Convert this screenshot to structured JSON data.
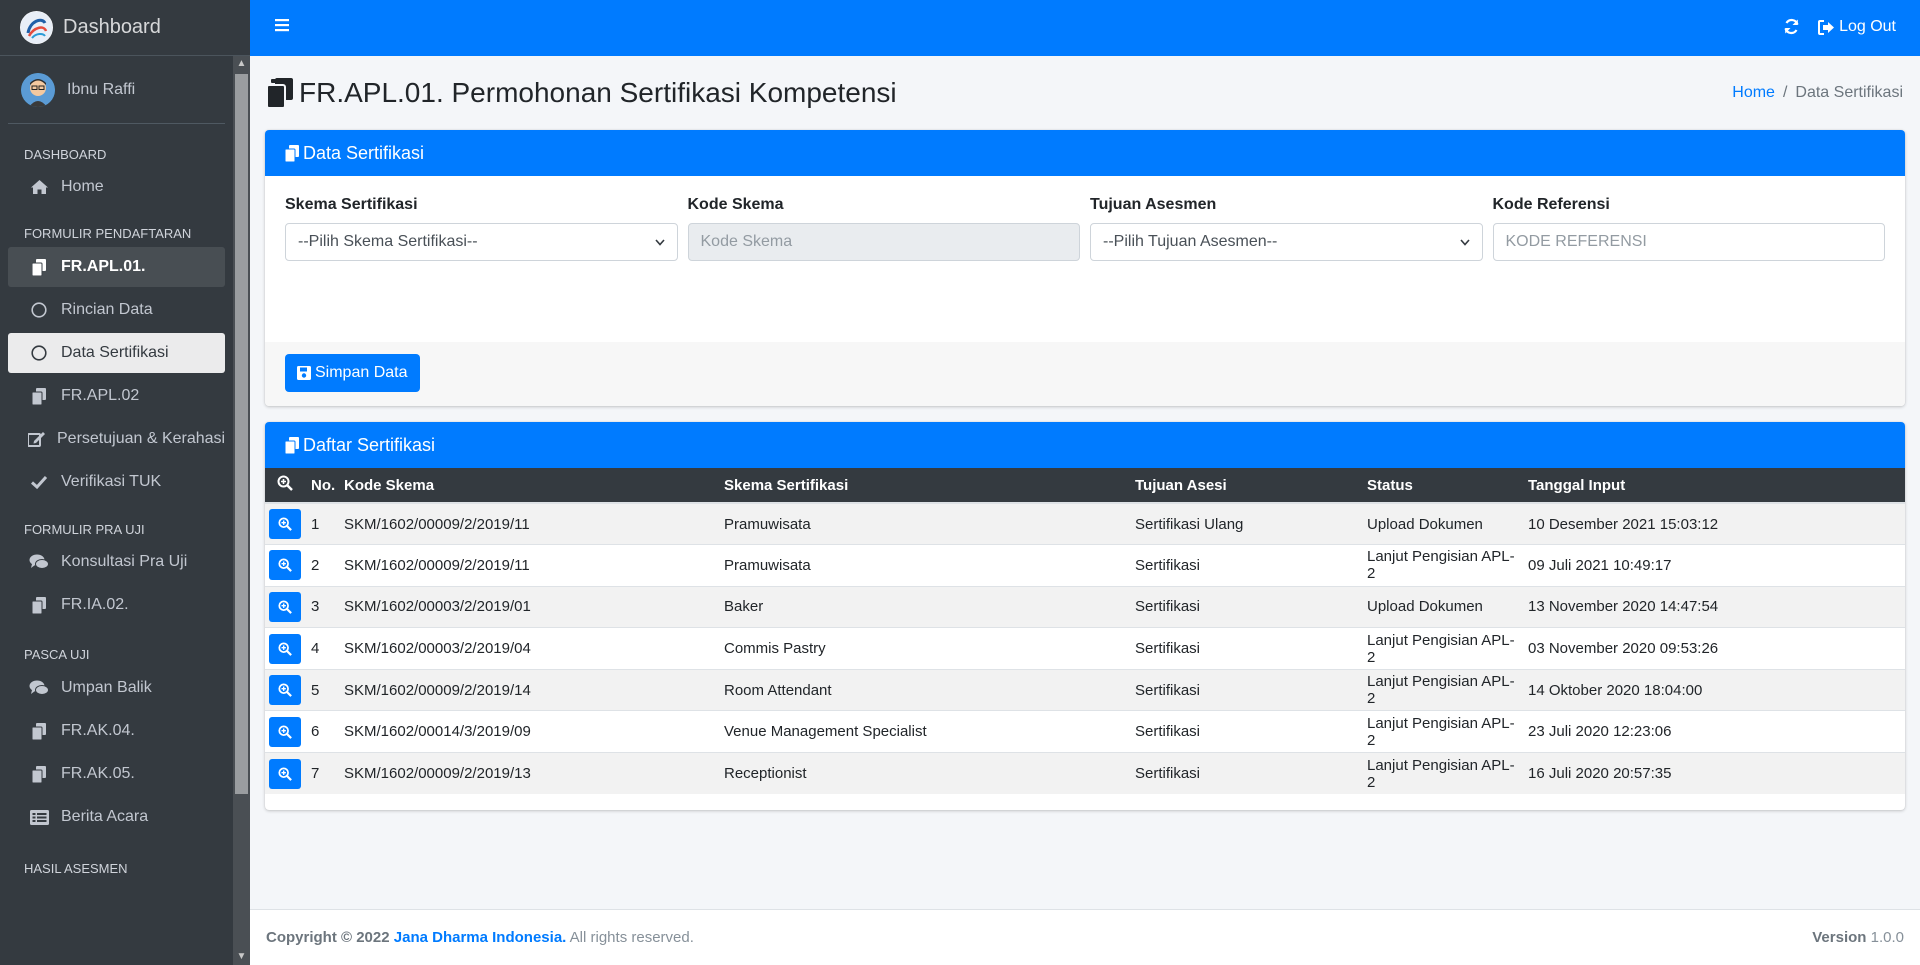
{
  "brand": {
    "title": "Dashboard"
  },
  "user": {
    "name": "Ibnu Raffi"
  },
  "sidebar": {
    "sections": [
      {
        "header": "DASHBOARD",
        "items": [
          {
            "label": "Home",
            "icon": "home-icon"
          }
        ]
      },
      {
        "header": "FORMULIR PENDAFTARAN",
        "items": [
          {
            "label": "FR.APL.01.",
            "icon": "copy-icon",
            "state": "parent-active"
          },
          {
            "label": "Rincian Data",
            "icon": "circle-icon"
          },
          {
            "label": "Data Sertifikasi",
            "icon": "circle-icon",
            "state": "active"
          },
          {
            "label": "FR.APL.02",
            "icon": "copy-icon"
          },
          {
            "label": "Persetujuan & Kerahasiaan",
            "icon": "edit-icon"
          },
          {
            "label": "Verifikasi TUK",
            "icon": "check-icon"
          }
        ]
      },
      {
        "header": "FORMULIR PRA UJI",
        "items": [
          {
            "label": "Konsultasi Pra Uji",
            "icon": "comments-icon"
          },
          {
            "label": "FR.IA.02.",
            "icon": "copy-icon"
          }
        ]
      },
      {
        "header": "PASCA UJI",
        "items": [
          {
            "label": "Umpan Balik",
            "icon": "comments-icon"
          },
          {
            "label": "FR.AK.04.",
            "icon": "copy-icon"
          },
          {
            "label": "FR.AK.05.",
            "icon": "copy-icon"
          },
          {
            "label": "Berita Acara",
            "icon": "list-icon"
          }
        ]
      },
      {
        "header": "HASIL ASESMEN",
        "items": []
      }
    ]
  },
  "navbar": {
    "logout_label": "Log Out"
  },
  "page": {
    "title": "FR.APL.01. Permohonan Sertifikasi Kompetensi",
    "breadcrumb": {
      "home": "Home",
      "current": "Data Sertifikasi"
    }
  },
  "form_card": {
    "title": "Data Sertifikasi",
    "fields": {
      "skema": {
        "label": "Skema Sertifikasi",
        "value": "--Pilih Skema Sertifikasi--"
      },
      "kode": {
        "label": "Kode Skema",
        "placeholder": "Kode Skema"
      },
      "tujuan": {
        "label": "Tujuan Asesmen",
        "value": "--Pilih Tujuan Asesmen--"
      },
      "referensi": {
        "label": "Kode Referensi",
        "placeholder": "KODE REFERENSI"
      }
    },
    "save_label": "Simpan Data"
  },
  "list_card": {
    "title": "Daftar Sertifikasi",
    "columns": [
      "No.",
      "Kode Skema",
      "Skema Sertifikasi",
      "Tujuan Asesi",
      "Status",
      "Tanggal Input"
    ],
    "rows": [
      [
        "1",
        "SKM/1602/00009/2/2019/11",
        "Pramuwisata",
        "Sertifikasi Ulang",
        "Upload Dokumen",
        "10 Desember 2021 15:03:12"
      ],
      [
        "2",
        "SKM/1602/00009/2/2019/11",
        "Pramuwisata",
        "Sertifikasi",
        "Lanjut Pengisian APL-2",
        "09 Juli 2021 10:49:17"
      ],
      [
        "3",
        "SKM/1602/00003/2/2019/01",
        "Baker",
        "Sertifikasi",
        "Upload Dokumen",
        "13 November 2020 14:47:54"
      ],
      [
        "4",
        "SKM/1602/00003/2/2019/04",
        "Commis Pastry",
        "Sertifikasi",
        "Lanjut Pengisian APL-2",
        "03 November 2020 09:53:26"
      ],
      [
        "5",
        "SKM/1602/00009/2/2019/14",
        "Room Attendant",
        "Sertifikasi",
        "Lanjut Pengisian APL-2",
        "14 Oktober 2020 18:04:00"
      ],
      [
        "6",
        "SKM/1602/00014/3/2019/09",
        "Venue Management Specialist",
        "Sertifikasi",
        "Lanjut Pengisian APL-2",
        "23 Juli 2020 12:23:06"
      ],
      [
        "7",
        "SKM/1602/00009/2/2019/13",
        "Receptionist",
        "Sertifikasi",
        "Lanjut Pengisian APL-2",
        "16 Juli 2020 20:57:35"
      ]
    ]
  },
  "footer": {
    "copyright": "Copyright © 2022",
    "company": "Jana Dharma Indonesia.",
    "rights": "All rights reserved.",
    "version_label": "Version",
    "version": "1.0.0"
  },
  "colors": {
    "primary": "#007bff",
    "sidebar": "#343a40",
    "table_head": "#343a40"
  }
}
